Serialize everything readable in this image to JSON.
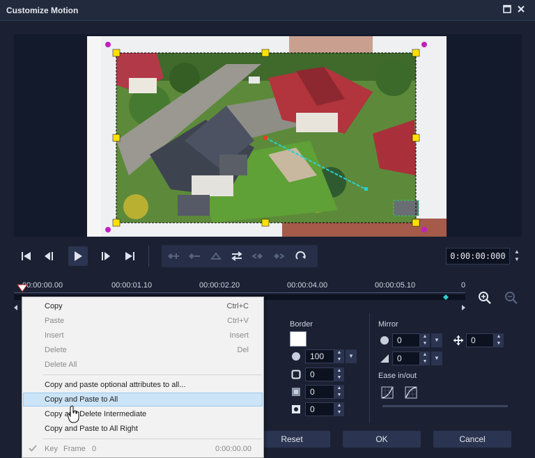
{
  "window": {
    "title": "Customize Motion"
  },
  "transport": {
    "timecode": "0:00:00:000"
  },
  "timeline": {
    "ticks": [
      "00:00:00.00",
      "00:00:01.10",
      "00:00:02.20",
      "00:00:04.00",
      "00:00:05.10",
      "0"
    ]
  },
  "border": {
    "title": "Border",
    "opacity": "100",
    "size": "0",
    "blur": "0",
    "shadow": "0"
  },
  "mirror": {
    "title": "Mirror",
    "value1": "0",
    "value2": "0",
    "offset": "0"
  },
  "ease": {
    "title": "Ease in/out"
  },
  "buttons": {
    "reset": "Reset",
    "ok": "OK",
    "cancel": "Cancel"
  },
  "context_menu": {
    "items": [
      {
        "label": "Copy",
        "shortcut": "Ctrl+C"
      },
      {
        "label": "Paste",
        "shortcut": "Ctrl+V"
      },
      {
        "label": "Insert",
        "shortcut": "Insert"
      },
      {
        "label": "Delete",
        "shortcut": "Del"
      },
      {
        "label": "Delete All",
        "shortcut": ""
      },
      {
        "label": "Copy and paste optional attributes to all...",
        "shortcut": ""
      },
      {
        "label": "Copy and Paste to All",
        "shortcut": ""
      },
      {
        "label": "Copy and Delete Intermediate",
        "shortcut": ""
      },
      {
        "label": "Copy and Paste to All Right",
        "shortcut": ""
      }
    ],
    "key_row": {
      "label": "Key",
      "frame_label": "Frame",
      "frame_value": "0",
      "time": "0:00:00.00"
    }
  },
  "colors": {
    "background": "#1b2133",
    "accent_cyan": "#2ad0d0",
    "handle_yellow": "#ffe000",
    "handle_magenta": "#c020c0",
    "menu_highlight": "#cce4f7"
  }
}
